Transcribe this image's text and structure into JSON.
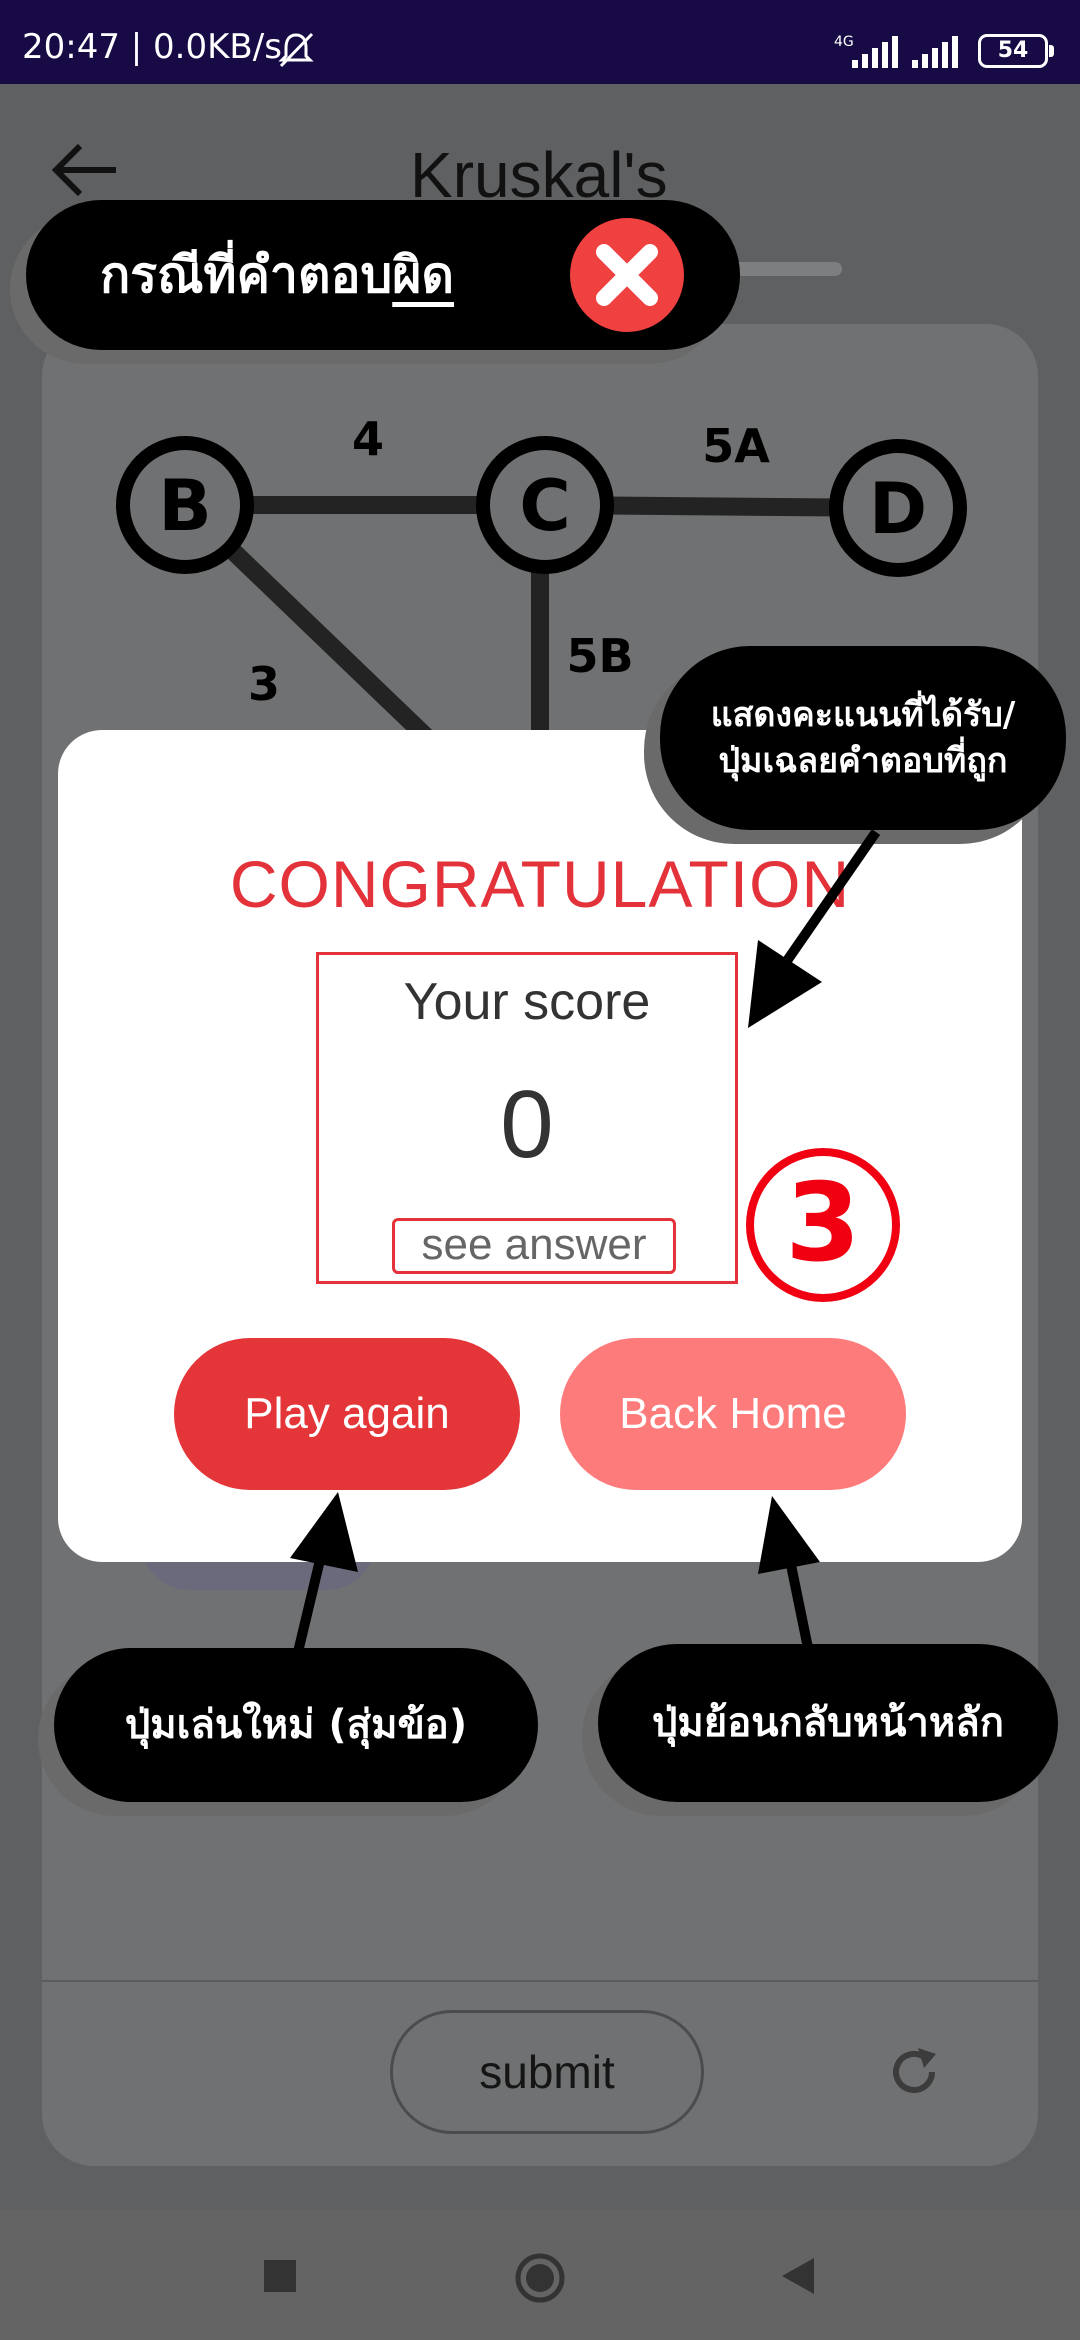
{
  "status_bar": {
    "time_speed": "20:47 | 0.0KB/s",
    "network": "4G",
    "battery": "54"
  },
  "header": {
    "title": "Kruskal's"
  },
  "graph": {
    "nodes": [
      "B",
      "C",
      "D"
    ],
    "edge_labels": [
      "4",
      "5A",
      "3",
      "5B"
    ]
  },
  "footer": {
    "submit_label": "submit"
  },
  "dialog": {
    "title": "CONGRATULATION",
    "score_label": "Your score",
    "score_value": "0",
    "see_answer_label": "see answer",
    "play_again_label": "Play again",
    "back_home_label": "Back Home"
  },
  "annotations": {
    "wrong_case_prefix": "กรณีที่คำตอบ",
    "wrong_case_emph": "ผิด",
    "score_note_line1": "แสดงคะแนนที่ได้รับ/",
    "score_note_line2": "ปุ่มเฉลยคำตอบที่ถูก",
    "play_again_note": "ปุ่มเล่นใหม่ (สุ่มข้อ)",
    "back_home_note": "ปุ่มย้อนกลับหน้าหลัก",
    "step_number": "3"
  },
  "colors": {
    "accent_red": "#e43539",
    "back_home_pink": "#fe7b7b",
    "status_bar": "#170a45"
  }
}
